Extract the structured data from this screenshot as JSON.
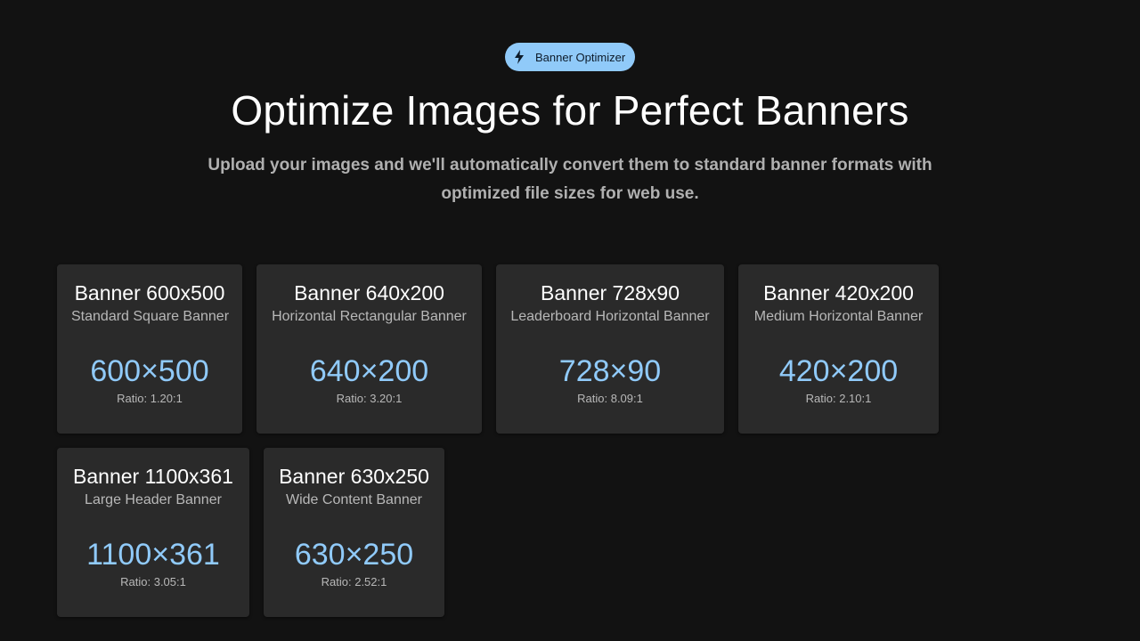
{
  "header": {
    "badge_label": "Banner Optimizer",
    "badge_icon": "bolt-icon",
    "title": "Optimize Images for Perfect Banners",
    "subtitle": "Upload your images and we'll automatically convert them to standard banner formats with optimized file sizes for web use."
  },
  "colors": {
    "background": "#121212",
    "card": "#2a2a2a",
    "accent": "#90caf9"
  },
  "banners": [
    {
      "name": "Banner 600x500",
      "description": "Standard Square Banner",
      "dims": "600×500",
      "ratio": "Ratio: 1.20:1"
    },
    {
      "name": "Banner 640x200",
      "description": "Horizontal Rectangular Banner",
      "dims": "640×200",
      "ratio": "Ratio: 3.20:1"
    },
    {
      "name": "Banner 728x90",
      "description": "Leaderboard Horizontal Banner",
      "dims": "728×90",
      "ratio": "Ratio: 8.09:1"
    },
    {
      "name": "Banner 420x200",
      "description": "Medium Horizontal Banner",
      "dims": "420×200",
      "ratio": "Ratio: 2.10:1"
    },
    {
      "name": "Banner 1100x361",
      "description": "Large Header Banner",
      "dims": "1100×361",
      "ratio": "Ratio: 3.05:1"
    },
    {
      "name": "Banner 630x250",
      "description": "Wide Content Banner",
      "dims": "630×250",
      "ratio": "Ratio: 2.52:1"
    }
  ]
}
